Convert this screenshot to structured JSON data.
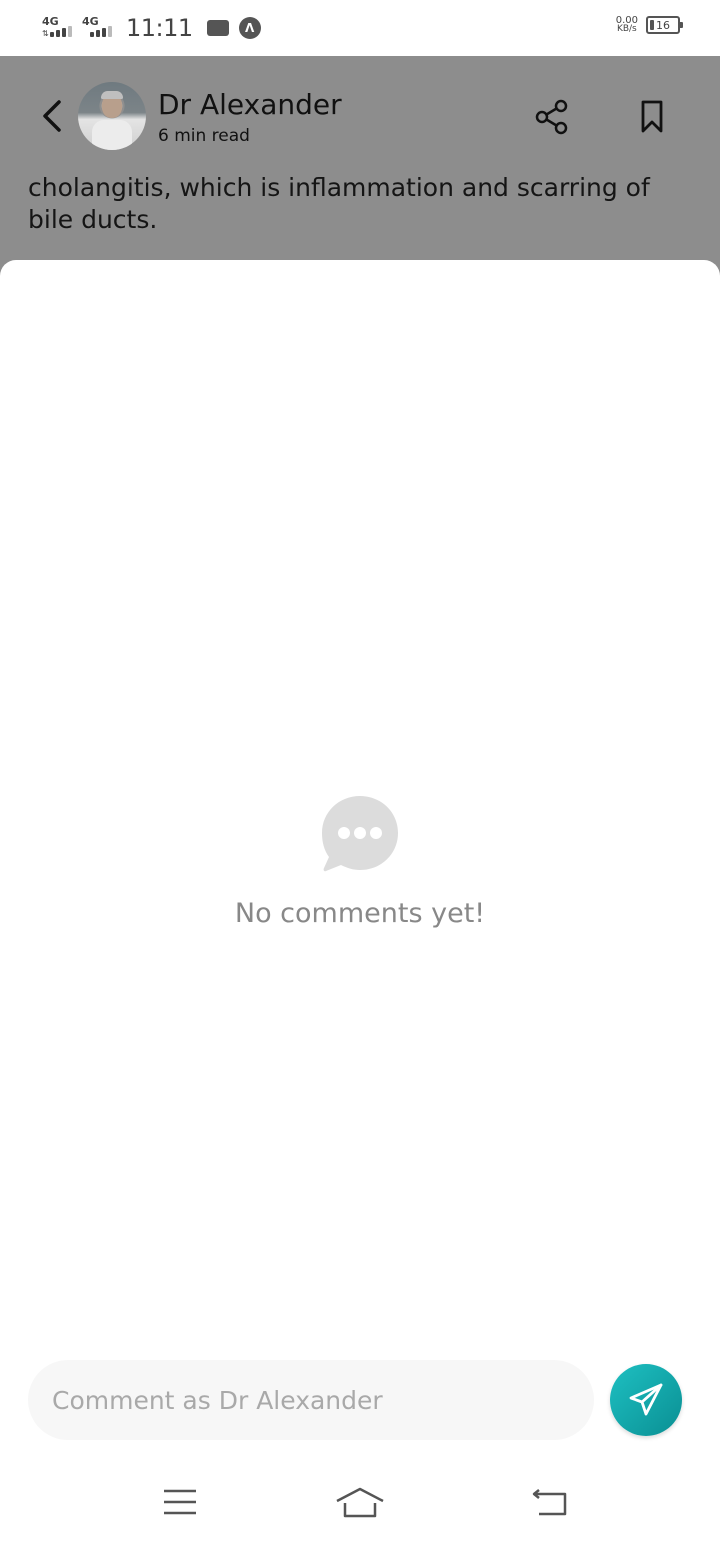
{
  "status_bar": {
    "network_1": "4G",
    "network_2": "4G",
    "time": "11:11",
    "speed_value": "0.00",
    "speed_unit": "KB/s",
    "battery": "16"
  },
  "header": {
    "author_name": "Dr Alexander",
    "read_time": "6 min read",
    "article_excerpt": "cholangitis, which is inflammation and scarring of bile ducts."
  },
  "comments": {
    "empty_message": "No comments yet!",
    "input_placeholder": "Comment as Dr Alexander"
  },
  "icons": {
    "back": "chevron-left-icon",
    "share": "share-icon",
    "bookmark": "bookmark-icon",
    "empty": "chat-bubble-icon",
    "send": "paper-plane-icon",
    "nav_menu": "menu-icon",
    "nav_home": "home-icon",
    "nav_back": "back-icon"
  },
  "colors": {
    "accent": "#14a8ab",
    "overlay": "#8d8d8d",
    "muted_text": "#888888"
  }
}
